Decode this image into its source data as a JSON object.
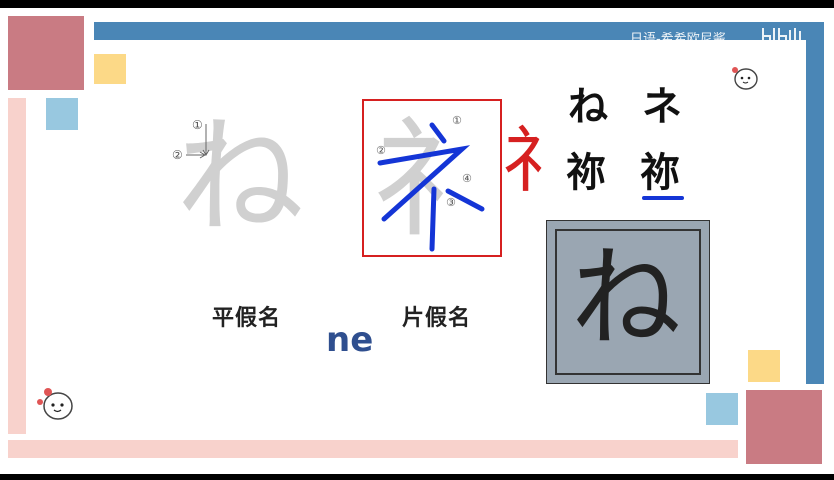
{
  "watermark": "日语-希希欧尼酱",
  "labels": {
    "hiragana": "平假名",
    "katakana": "片假名",
    "romaji": "ne"
  },
  "chars": {
    "hira_outline": "ね",
    "kata_source": "礻",
    "kata_red": "礻",
    "pair_hira": "ね",
    "pair_kata": "ネ",
    "origin_left": "祢",
    "origin_right": "祢",
    "handwritten": "ね"
  },
  "stroke_order": {
    "hira": [
      "①",
      "②"
    ],
    "kata": [
      "①",
      "②",
      "③",
      "④"
    ]
  },
  "colors": {
    "frame_top": "#4a86b6",
    "frame_pink": "#f8d2cc",
    "rose": "#c97b83",
    "yellow": "#fcd987",
    "lightblue": "#98c8e0",
    "kata_box": "#d62020",
    "kata_strokes": "#1435d6"
  },
  "icons": [
    "mascot-icon",
    "bilibili-logo-icon"
  ]
}
